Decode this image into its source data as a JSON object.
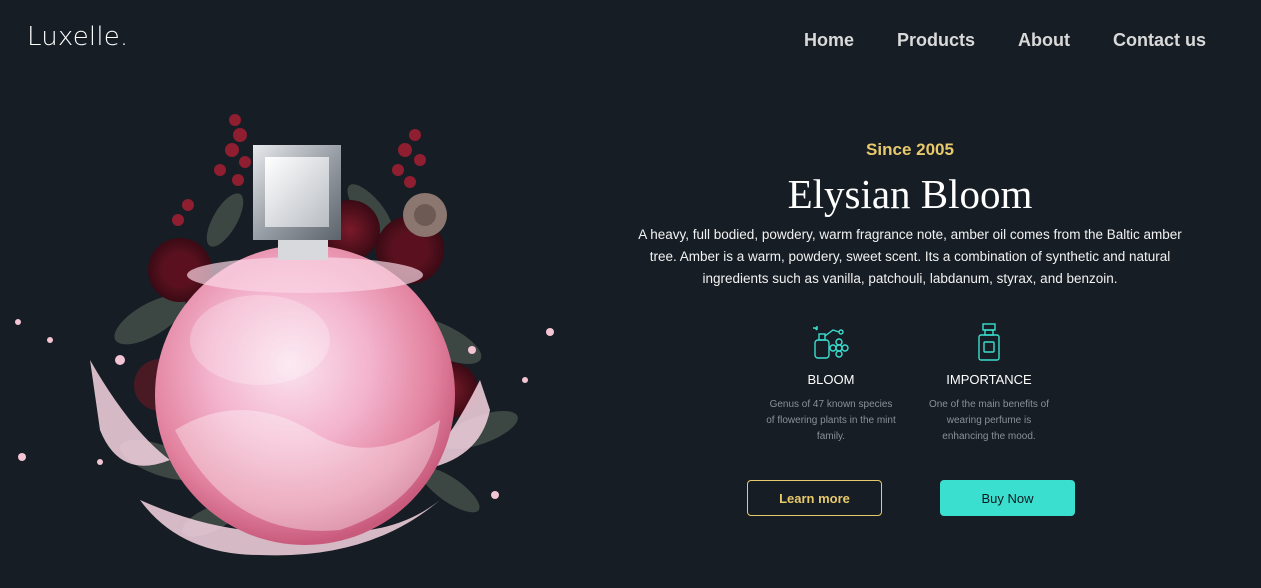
{
  "brand": {
    "logo": "Luxelle."
  },
  "nav": {
    "items": [
      {
        "label": "Home"
      },
      {
        "label": "Products"
      },
      {
        "label": "About"
      },
      {
        "label": "Contact us"
      }
    ]
  },
  "hero": {
    "kicker": "Since 2005",
    "title": "Elysian Bloom",
    "description": "A heavy, full bodied, powdery, warm fragrance note, amber oil comes from the Baltic amber tree. Amber is a warm, powdery, sweet scent. Its a combination of synthetic and natural ingredients such as vanilla, patchouli, labdanum, styrax, and benzoin.",
    "features": [
      {
        "icon": "perfume-flower-icon",
        "title": "BLOOM",
        "text": "Genus of 47 known species of flowering plants in the mint family."
      },
      {
        "icon": "perfume-bottle-icon",
        "title": "IMPORTANCE",
        "text": "One of the main benefits of wearing perfume is enhancing the mood."
      }
    ],
    "buttons": {
      "learn_more": "Learn more",
      "buy_now": "Buy Now"
    }
  },
  "colors": {
    "background": "#161d24",
    "accent_gold": "#e8c96b",
    "accent_teal": "#3bdfcf"
  }
}
